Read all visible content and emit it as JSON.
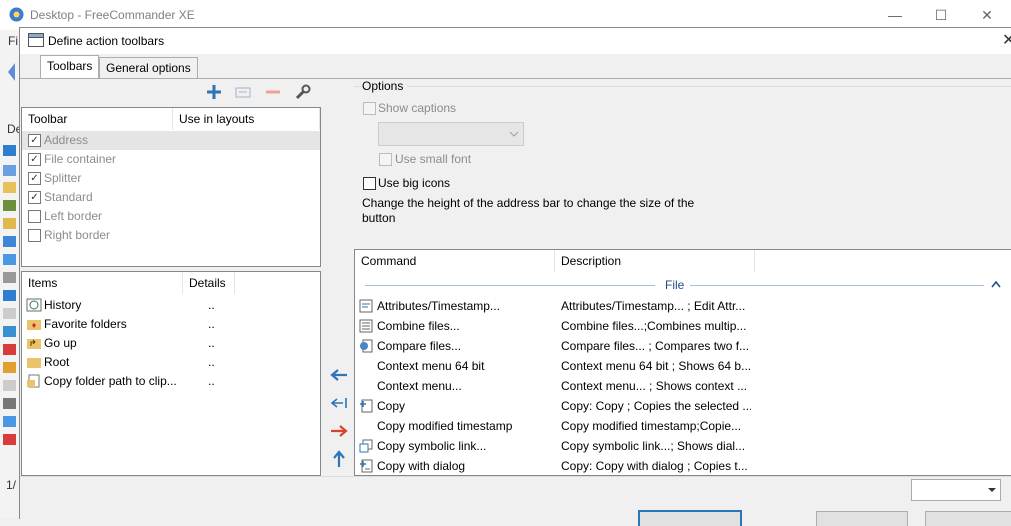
{
  "main_window": {
    "title": "Desktop - FreeCommander XE",
    "minimize_glyph": "—",
    "maximize_glyph": "☐",
    "close_glyph": "✕",
    "bg_menu_fragment": "Fi",
    "bg_tab_fragment": "De",
    "bg_status_fragment": "1/"
  },
  "dialog": {
    "title": "Define action toolbars",
    "close_glyph": "✕",
    "tabs": [
      {
        "label": "Toolbars",
        "active": true
      },
      {
        "label": "General options",
        "active": false
      }
    ],
    "toolbar_icons": [
      "add-icon",
      "edit-icon",
      "remove-icon",
      "wrench-icon"
    ],
    "toolbar_list": {
      "headers": [
        "Toolbar",
        "Use in layouts"
      ],
      "rows": [
        {
          "label": "Address",
          "checked": true,
          "selected": true
        },
        {
          "label": "File container",
          "checked": true,
          "selected": false
        },
        {
          "label": "Splitter",
          "checked": true,
          "selected": false
        },
        {
          "label": "Standard",
          "checked": true,
          "selected": false
        },
        {
          "label": "Left border",
          "checked": false,
          "selected": false
        },
        {
          "label": "Right border",
          "checked": false,
          "selected": false
        }
      ]
    },
    "items_list": {
      "headers": [
        "Items",
        "Details"
      ],
      "rows": [
        {
          "label": "History",
          "details": "..",
          "icon": "history-icon"
        },
        {
          "label": "Favorite folders",
          "details": "..",
          "icon": "favorite-folder-icon"
        },
        {
          "label": "Go up",
          "details": "..",
          "icon": "folder-up-icon"
        },
        {
          "label": "Root",
          "details": "..",
          "icon": "folder-icon"
        },
        {
          "label": "Copy folder path to clip...",
          "details": "..",
          "icon": "copy-path-icon"
        }
      ]
    },
    "options": {
      "group_label": "Options",
      "show_captions": "Show captions",
      "use_small_font": "Use small font",
      "use_big_icons": "Use big icons",
      "hint": "Change the height of the address bar to change the size of the button"
    },
    "commands": {
      "headers": [
        "Command",
        "Description"
      ],
      "group": "File",
      "collapse_glyph": "^",
      "rows": [
        {
          "name": "Attributes/Timestamp...",
          "desc": "Attributes/Timestamp... ; Edit Attr...",
          "icon": "attributes-icon"
        },
        {
          "name": "Combine files...",
          "desc": "Combine files...;Combines multip...",
          "icon": "combine-icon"
        },
        {
          "name": "Compare files...",
          "desc": "Compare files... ; Compares two f...",
          "icon": "compare-icon"
        },
        {
          "name": "Context menu 64 bit",
          "desc": "Context menu 64 bit ; Shows 64 b...",
          "icon": ""
        },
        {
          "name": "Context menu...",
          "desc": "Context menu... ; Shows context ...",
          "icon": ""
        },
        {
          "name": "Copy",
          "desc": "Copy: Copy ; Copies the selected ...",
          "icon": "copy-icon"
        },
        {
          "name": "Copy modified timestamp",
          "desc": "Copy modified timestamp;Copie...",
          "icon": ""
        },
        {
          "name": "Copy symbolic link...",
          "desc": "Copy symbolic link...; Shows dial...",
          "icon": "symlink-icon"
        },
        {
          "name": "Copy with dialog",
          "desc": "Copy: Copy with dialog ; Copies t...",
          "icon": "copy-dialog-icon"
        }
      ]
    },
    "arrows": [
      "arrow-left-icon",
      "arrow-left-bar-icon",
      "arrow-right-icon",
      "arrow-up-icon"
    ],
    "colors": {
      "accent": "#2e75b6",
      "red": "#d9452b",
      "selection": "#e5e5e5"
    }
  }
}
